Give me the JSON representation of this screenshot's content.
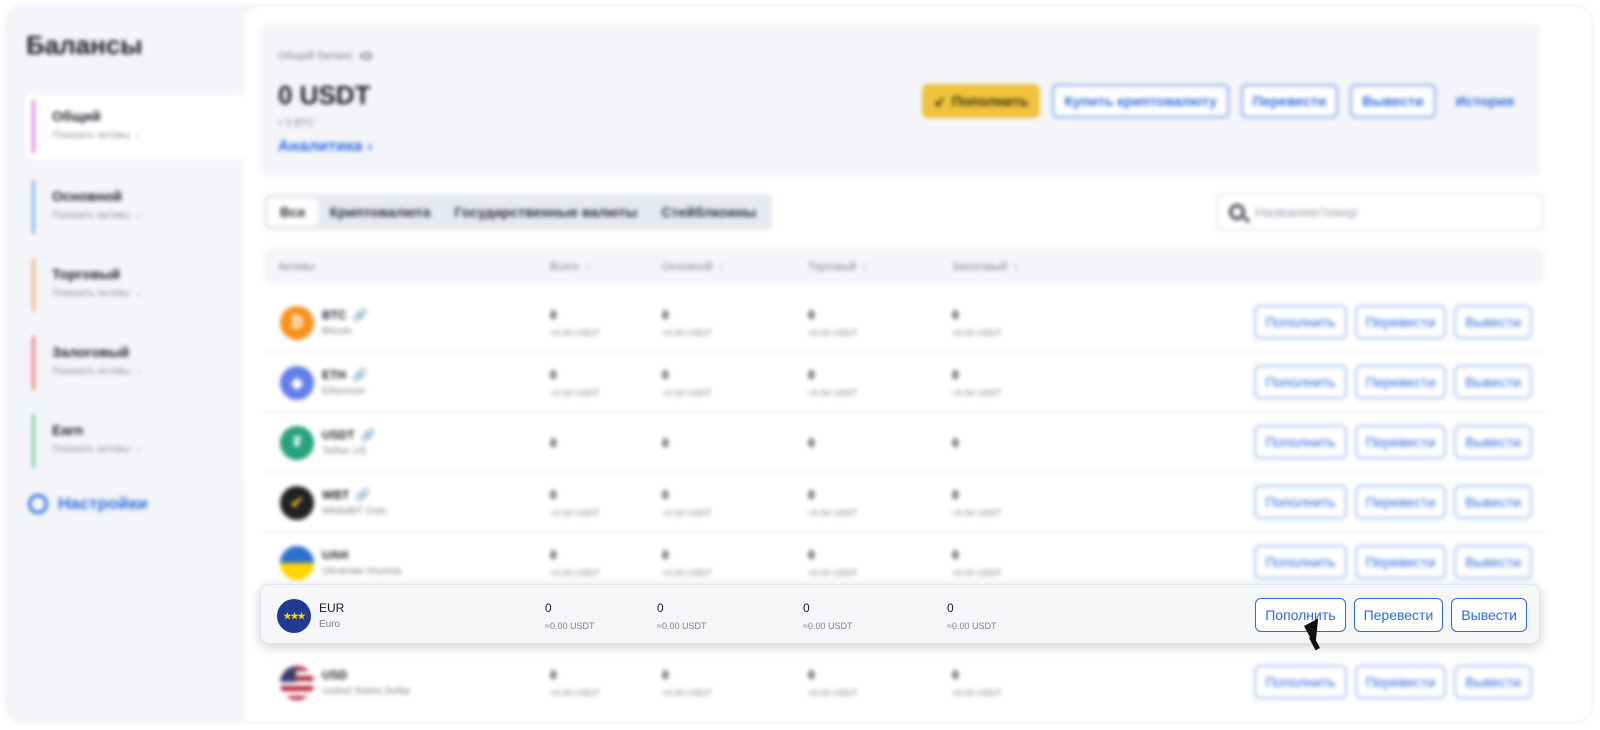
{
  "sidebar": {
    "title": "Балансы",
    "items": [
      {
        "label": "Общий",
        "sub": "Показать активы →",
        "color": "#e27ad8"
      },
      {
        "label": "Основной",
        "sub": "Показать активы →",
        "color": "#7bb3ee"
      },
      {
        "label": "Торговый",
        "sub": "Показать активы →",
        "color": "#f0b47a"
      },
      {
        "label": "Залоговый",
        "sub": "Показать активы →",
        "color": "#ec7b7b"
      },
      {
        "label": "Earn",
        "sub": "Показать активы →",
        "color": "#6fd08f"
      }
    ],
    "settings_label": "Настройки"
  },
  "balance": {
    "label": "Общий баланс",
    "amount": "0 USDT",
    "btc": "≈ 0 BTC",
    "analytics": "Аналитика",
    "deposit": "Пополнить",
    "buy": "Купить криптовалюту",
    "transfer": "Перевести",
    "withdraw": "Вывести",
    "history": "История"
  },
  "filters": {
    "tabs": [
      "Все",
      "Криптовалюта",
      "Государственные валюты",
      "Стейблкоины"
    ],
    "active_tab": "Все",
    "search_placeholder": "Название/тикер"
  },
  "table": {
    "headers": {
      "asset": "Активы",
      "total": "Всего",
      "main": "Основной",
      "trade": "Торговый",
      "collateral": "Залоговый"
    },
    "actions": {
      "deposit": "Пополнить",
      "transfer": "Перевести",
      "withdraw": "Вывести"
    },
    "rows": [
      {
        "ticker": "BTC",
        "name": "Bitcoin",
        "icon": "bitcoin-icon",
        "color": "#f7931a",
        "total": "0",
        "total_usdt": "≈0.00 USDT",
        "main": "0",
        "main_usdt": "≈0.00 USDT",
        "trade": "0",
        "trade_usdt": "≈0.00 USDT",
        "collateral": "0",
        "collateral_usdt": "≈0.00 USDT"
      },
      {
        "ticker": "ETH",
        "name": "Ethereum",
        "icon": "ethereum-icon",
        "color": "#627eea",
        "total": "0",
        "total_usdt": "≈0.00 USDT",
        "main": "0",
        "main_usdt": "≈0.00 USDT",
        "trade": "0",
        "trade_usdt": "≈0.00 USDT",
        "collateral": "0",
        "collateral_usdt": "≈0.00 USDT"
      },
      {
        "ticker": "USDT",
        "name": "Tether US",
        "icon": "tether-icon",
        "color": "#26a17b",
        "total": "0",
        "main": "0",
        "trade": "0",
        "collateral": "0"
      },
      {
        "ticker": "WBT",
        "name": "WhiteBIT Coin",
        "icon": "whitebit-icon",
        "color": "#222222",
        "total": "0",
        "total_usdt": "≈0.00 USDT",
        "main": "0",
        "main_usdt": "≈0.00 USDT",
        "trade": "0",
        "trade_usdt": "≈0.00 USDT",
        "collateral": "0",
        "collateral_usdt": "≈0.00 USDT"
      },
      {
        "ticker": "UAH",
        "name": "Ukrainian Hryvnia",
        "icon": "ukraine-flag-icon",
        "color": "#ffd500",
        "total": "0",
        "total_usdt": "≈0.00 USDT",
        "main": "0",
        "main_usdt": "≈0.00 USDT",
        "trade": "0",
        "trade_usdt": "≈0.00 USDT",
        "collateral": "0",
        "collateral_usdt": "≈0.00 USDT"
      },
      {
        "ticker": "EUR",
        "name": "Euro",
        "icon": "eu-flag-icon",
        "color": "#1f3a93",
        "total": "0",
        "total_usdt": "≈0.00 USDT",
        "main": "0",
        "main_usdt": "≈0.00 USDT",
        "trade": "0",
        "trade_usdt": "≈0.00 USDT",
        "collateral": "0",
        "collateral_usdt": "≈0.00 USDT"
      },
      {
        "ticker": "USD",
        "name": "United States Dollar",
        "icon": "us-flag-icon",
        "color": "#b22234",
        "total": "0",
        "total_usdt": "≈0.00 USDT",
        "main": "0",
        "main_usdt": "≈0.00 USDT",
        "trade": "0",
        "trade_usdt": "≈0.00 USDT",
        "collateral": "0",
        "collateral_usdt": "≈0.00 USDT"
      }
    ]
  }
}
